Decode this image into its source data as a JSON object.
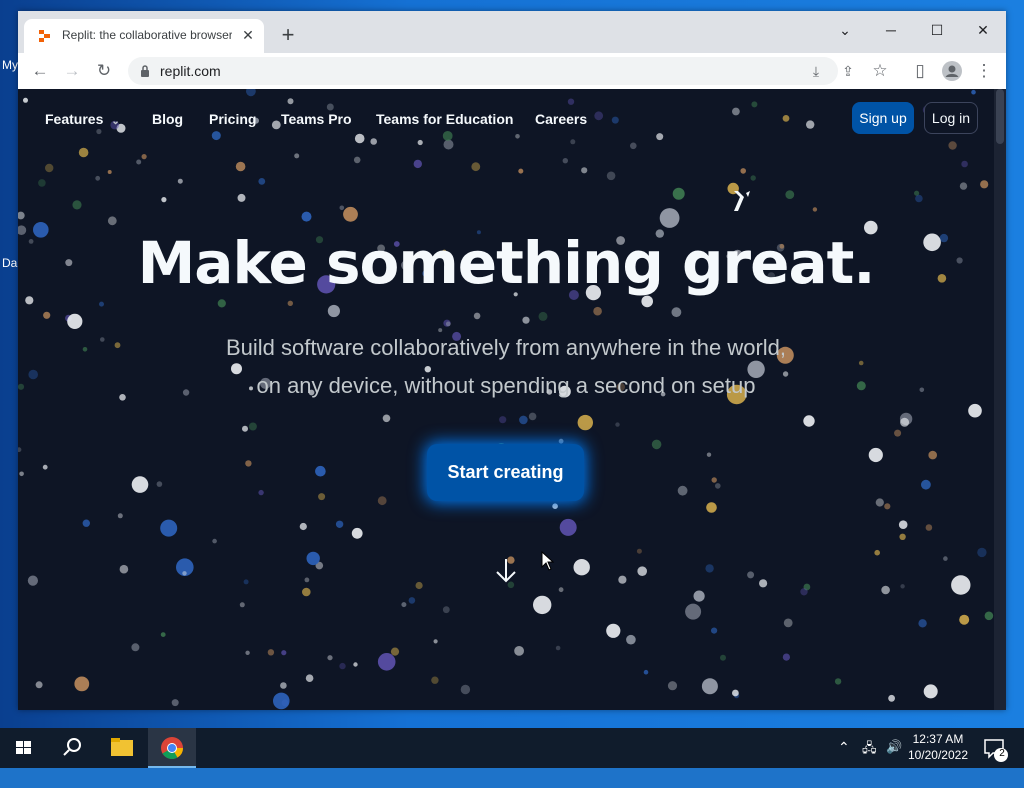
{
  "desktop": {
    "icon_label_1": "My",
    "icon_label_2": "Da"
  },
  "browser": {
    "tab_title": "Replit: the collaborative browser",
    "url": "replit.com"
  },
  "page": {
    "nav": {
      "features": "Features",
      "blog": "Blog",
      "pricing": "Pricing",
      "teams_pro": "Teams Pro",
      "teams_education": "Teams for Education",
      "careers": "Careers",
      "sign_up": "Sign up",
      "log_in": "Log in"
    },
    "headline": "Make something great.",
    "subline_1": "Build software collaboratively from anywhere in the world,",
    "subline_2": "on any device, without spending a second on setup",
    "cta": "Start creating"
  },
  "taskbar": {
    "time": "12:37 AM",
    "date": "10/20/2022",
    "notification_count": "2"
  },
  "colors": {
    "page_bg": "#0e1525",
    "primary_button": "#0053a6",
    "taskbar": "#101c2c"
  }
}
